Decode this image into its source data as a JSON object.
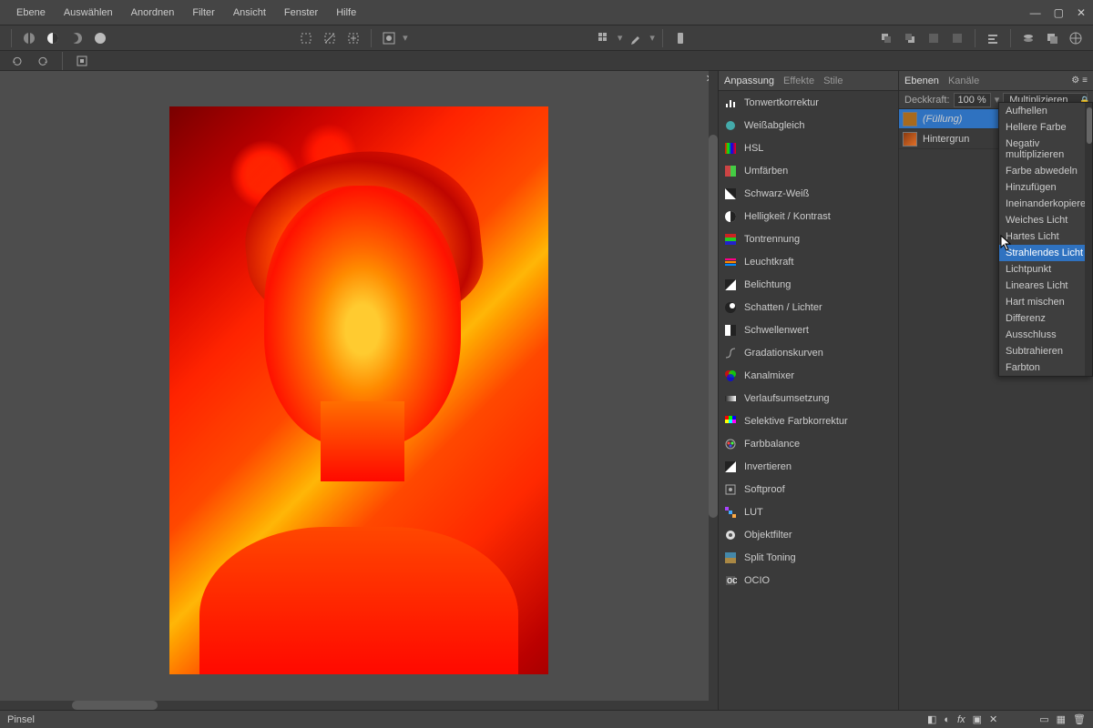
{
  "menu": {
    "items": [
      "Ebene",
      "Auswählen",
      "Anordnen",
      "Filter",
      "Ansicht",
      "Fenster",
      "Hilfe"
    ]
  },
  "panels": {
    "adjustments": {
      "tabs": [
        "Anpassung",
        "Effekte",
        "Stile"
      ],
      "active_tab": "Anpassung",
      "items": [
        {
          "label": "Tonwertkorrektur",
          "icon": "levels"
        },
        {
          "label": "Weißabgleich",
          "icon": "wb"
        },
        {
          "label": "HSL",
          "icon": "hsl"
        },
        {
          "label": "Umfärben",
          "icon": "recolor"
        },
        {
          "label": "Schwarz-Weiß",
          "icon": "bw"
        },
        {
          "label": "Helligkeit / Kontrast",
          "icon": "bc"
        },
        {
          "label": "Tontrennung",
          "icon": "posterize"
        },
        {
          "label": "Leuchtkraft",
          "icon": "vibrance"
        },
        {
          "label": "Belichtung",
          "icon": "exposure"
        },
        {
          "label": "Schatten / Lichter",
          "icon": "shadows"
        },
        {
          "label": "Schwellenwert",
          "icon": "threshold"
        },
        {
          "label": "Gradationskurven",
          "icon": "curves"
        },
        {
          "label": "Kanalmixer",
          "icon": "channelmix"
        },
        {
          "label": "Verlaufsumsetzung",
          "icon": "gradmap"
        },
        {
          "label": "Selektive Farbkorrektur",
          "icon": "selectcol"
        },
        {
          "label": "Farbbalance",
          "icon": "colorbal"
        },
        {
          "label": "Invertieren",
          "icon": "invert"
        },
        {
          "label": "Softproof",
          "icon": "softproof"
        },
        {
          "label": "LUT",
          "icon": "lut"
        },
        {
          "label": "Objektfilter",
          "icon": "lens"
        },
        {
          "label": "Split Toning",
          "icon": "split"
        },
        {
          "label": "OCIO",
          "icon": "ocio"
        }
      ]
    },
    "layers": {
      "tabs": [
        "Ebenen",
        "Kanäle"
      ],
      "active_tab": "Ebenen",
      "opacity_label": "Deckkraft:",
      "opacity_value": "100 %",
      "blend_current": "Multiplizieren",
      "items": [
        {
          "name": "(Füllung)",
          "selected": true,
          "thumb": "fill",
          "italic": true
        },
        {
          "name": "Hintergrun",
          "selected": false,
          "thumb": "bg",
          "italic": false
        }
      ],
      "blend_dropdown": [
        "Aufhellen",
        "Hellere Farbe",
        "Negativ multiplizieren",
        "Farbe abwedeln",
        "Hinzufügen",
        "Ineinanderkopieren",
        "Weiches Licht",
        "Hartes Licht",
        "Strahlendes Licht",
        "Lichtpunkt",
        "Lineares Licht",
        "Hart mischen",
        "Differenz",
        "Ausschluss",
        "Subtrahieren",
        "Farbton"
      ],
      "blend_highlighted": "Strahlendes Licht"
    }
  },
  "status": {
    "left": "Pinsel"
  }
}
